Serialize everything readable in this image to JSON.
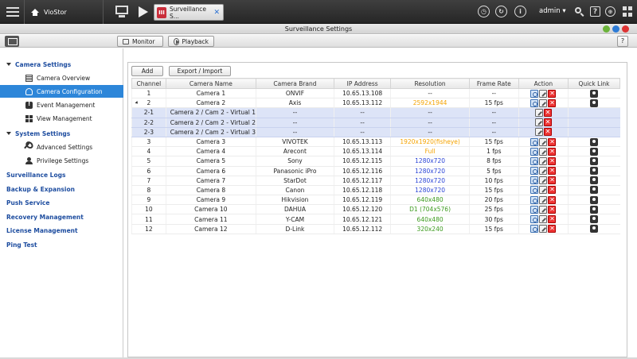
{
  "topbar": {
    "home_label": "VioStor",
    "app_tab_label": "Surveillance S...",
    "app_tab_logo": "III",
    "user": "admin",
    "user_caret": "▾"
  },
  "window": {
    "title": "Surveillance Settings"
  },
  "toolbar": {
    "monitor_label": "Monitor",
    "playback_label": "Playback",
    "help_label": "?"
  },
  "sidebar": {
    "camera_settings": "Camera Settings",
    "camera_overview": "Camera Overview",
    "camera_configuration": "Camera Configuration",
    "event_management": "Event Management",
    "view_management": "View Management",
    "system_settings": "System Settings",
    "advanced_settings": "Advanced Settings",
    "privilege_settings": "Privilege Settings",
    "surveillance_logs": "Surveillance Logs",
    "backup_expansion": "Backup & Expansion",
    "push_service": "Push Service",
    "recovery_management": "Recovery Management",
    "license_management": "License Management",
    "ping_test": "Ping Test"
  },
  "main": {
    "add_label": "Add",
    "export_label": "Export / Import",
    "columns": [
      "Channel",
      "Camera Name",
      "Camera Brand",
      "IP Address",
      "Resolution",
      "Frame Rate",
      "Action",
      "Quick Link"
    ],
    "rows": [
      {
        "channel": "1",
        "name": "Camera 1",
        "brand": "ONVIF",
        "ip": "10.65.13.108",
        "res": "--",
        "fps": "--"
      },
      {
        "channel": "2",
        "name": "Camera 2",
        "brand": "Axis",
        "ip": "10.65.13.112",
        "res": "2592x1944",
        "fps": "15 fps"
      },
      {
        "channel": "2-1",
        "name": "Camera 2 / Cam 2 - Virtual 1",
        "brand": "--",
        "ip": "--",
        "res": "--",
        "fps": "--"
      },
      {
        "channel": "2-2",
        "name": "Camera 2 / Cam 2 - Virtual 2",
        "brand": "--",
        "ip": "--",
        "res": "--",
        "fps": "--"
      },
      {
        "channel": "2-3",
        "name": "Camera 2 / Cam 2 - Virtual 3",
        "brand": "--",
        "ip": "--",
        "res": "--",
        "fps": "--"
      },
      {
        "channel": "3",
        "name": "Camera 3",
        "brand": "VIVOTEK",
        "ip": "10.65.13.113",
        "res": "1920x1920(fisheye)",
        "fps": "15 fps"
      },
      {
        "channel": "4",
        "name": "Camera 4",
        "brand": "Arecont",
        "ip": "10.65.13.114",
        "res": "Full",
        "fps": "1 fps"
      },
      {
        "channel": "5",
        "name": "Camera 5",
        "brand": "Sony",
        "ip": "10.65.12.115",
        "res": "1280x720",
        "fps": "8 fps"
      },
      {
        "channel": "6",
        "name": "Camera 6",
        "brand": "Panasonic iPro",
        "ip": "10.65.12.116",
        "res": "1280x720",
        "fps": "5 fps"
      },
      {
        "channel": "7",
        "name": "Camera 7",
        "brand": "StarDot",
        "ip": "10.65.12.117",
        "res": "1280x720",
        "fps": "10 fps"
      },
      {
        "channel": "8",
        "name": "Camera 8",
        "brand": "Canon",
        "ip": "10.65.12.118",
        "res": "1280x720",
        "fps": "15 fps"
      },
      {
        "channel": "9",
        "name": "Camera 9",
        "brand": "Hikvision",
        "ip": "10.65.12.119",
        "res": "640x480",
        "fps": "20 fps"
      },
      {
        "channel": "10",
        "name": "Camera 10",
        "brand": "DAHUA",
        "ip": "10.65.12.120",
        "res": "D1 (704x576)",
        "fps": "25 fps"
      },
      {
        "channel": "11",
        "name": "Camera 11",
        "brand": "Y-CAM",
        "ip": "10.65.12.121",
        "res": "640x480",
        "fps": "30 fps"
      },
      {
        "channel": "12",
        "name": "Camera 12",
        "brand": "D-Link",
        "ip": "10.65.12.112",
        "res": "320x240",
        "fps": "15 fps"
      }
    ],
    "delete_glyph": "✕"
  },
  "colors": {
    "accent": "#2d86d9",
    "res_orange": "#f5a300",
    "res_blue": "#2a44d6",
    "res_green": "#3c9a1e",
    "virtual_row_bg": "#dde4f7"
  }
}
